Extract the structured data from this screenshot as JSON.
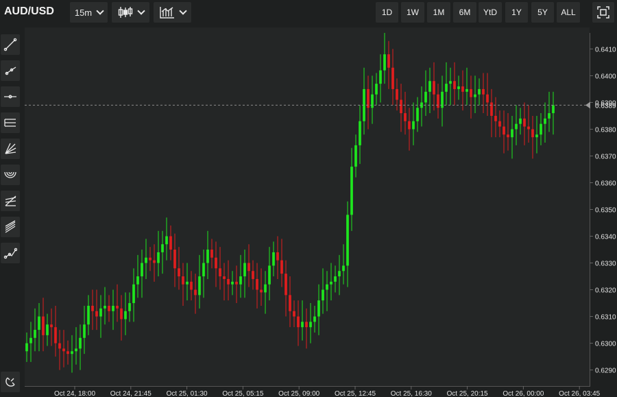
{
  "header": {
    "symbol": "AUD/USD",
    "interval_label": "15m",
    "chart_type_icon": "candlestick-icon",
    "indicators_icon": "indicators-icon",
    "ranges": [
      "1D",
      "1W",
      "1M",
      "6M",
      "YtD",
      "1Y",
      "5Y",
      "ALL"
    ],
    "fullscreen_icon": "fullscreen-icon"
  },
  "toolbar": {
    "tools": [
      "trend-line-icon",
      "ray-icon",
      "horizontal-line-icon",
      "parallel-channel-icon",
      "fib-fan-icon",
      "fib-arc-icon",
      "fib-retracement-icon",
      "pitchfork-icon",
      "path-icon",
      "magnet-icon"
    ]
  },
  "colors": {
    "up": "#1ee61e",
    "down": "#e01e1e",
    "background": "#242626",
    "axis_text": "#e0e0e0"
  },
  "chart_data": {
    "type": "candlestick",
    "title": "AUD/USD",
    "interval": "15m",
    "ylim": [
      0.6284,
      0.6416
    ],
    "y_ticks": [
      "0.6290",
      "0.6300",
      "0.6310",
      "0.6320",
      "0.6330",
      "0.6340",
      "0.6350",
      "0.6360",
      "0.6370",
      "0.6380",
      "0.6390",
      "0.6400",
      "0.6410"
    ],
    "x_ticks": [
      "Oct 24, 18:00",
      "Oct 24, 21:45",
      "Oct 25, 01:30",
      "Oct 25, 05:15",
      "Oct 25, 09:00",
      "Oct 25, 12:45",
      "Oct 25, 16:30",
      "Oct 25, 20:15",
      "Oct 26, 00:00",
      "Oct 26, 03:45"
    ],
    "last_price": "0.6389",
    "close": [
      0.63,
      0.6302,
      0.6305,
      0.631,
      0.6303,
      0.6307,
      0.6306,
      0.63,
      0.6298,
      0.6297,
      0.6296,
      0.6297,
      0.6298,
      0.6302,
      0.6307,
      0.6314,
      0.6312,
      0.631,
      0.6313,
      0.6314,
      0.6312,
      0.6314,
      0.6313,
      0.6309,
      0.6312,
      0.6315,
      0.6322,
      0.6325,
      0.633,
      0.6332,
      0.6331,
      0.633,
      0.6334,
      0.6337,
      0.634,
      0.6335,
      0.6328,
      0.6325,
      0.6322,
      0.6323,
      0.632,
      0.6318,
      0.6325,
      0.633,
      0.6335,
      0.6332,
      0.6328,
      0.6325,
      0.6324,
      0.6322,
      0.6323,
      0.6322,
      0.6325,
      0.633,
      0.6327,
      0.6324,
      0.632,
      0.6319,
      0.6322,
      0.6329,
      0.6334,
      0.6331,
      0.6326,
      0.6318,
      0.6312,
      0.631,
      0.6306,
      0.6308,
      0.6306,
      0.6308,
      0.631,
      0.6316,
      0.632,
      0.6322,
      0.6323,
      0.6325,
      0.6327,
      0.6329,
      0.6348,
      0.6366,
      0.6374,
      0.6383,
      0.6395,
      0.6388,
      0.6393,
      0.6397,
      0.6402,
      0.6408,
      0.6403,
      0.6395,
      0.6391,
      0.6386,
      0.6383,
      0.638,
      0.6383,
      0.6388,
      0.639,
      0.6394,
      0.6398,
      0.6393,
      0.6388,
      0.6394,
      0.6397,
      0.6398,
      0.6395,
      0.6396,
      0.6394,
      0.6395,
      0.6392,
      0.6393,
      0.6395,
      0.6393,
      0.639,
      0.6385,
      0.6383,
      0.6381,
      0.6378,
      0.6377,
      0.638,
      0.6382,
      0.6384,
      0.6381,
      0.638,
      0.6377,
      0.6378,
      0.6382,
      0.6384,
      0.6386,
      0.6389
    ],
    "open": [
      0.6297,
      0.63,
      0.6302,
      0.6305,
      0.631,
      0.6303,
      0.6307,
      0.6306,
      0.63,
      0.6298,
      0.6297,
      0.6296,
      0.6297,
      0.6298,
      0.6302,
      0.6307,
      0.6314,
      0.6312,
      0.631,
      0.6313,
      0.6314,
      0.6312,
      0.6314,
      0.6313,
      0.6309,
      0.6312,
      0.6315,
      0.6322,
      0.6325,
      0.633,
      0.6332,
      0.6331,
      0.633,
      0.6334,
      0.6337,
      0.634,
      0.6335,
      0.6328,
      0.6325,
      0.6322,
      0.6323,
      0.632,
      0.6318,
      0.6325,
      0.633,
      0.6335,
      0.6332,
      0.6328,
      0.6325,
      0.6324,
      0.6322,
      0.6323,
      0.6322,
      0.6325,
      0.633,
      0.6327,
      0.6324,
      0.632,
      0.6319,
      0.6322,
      0.6329,
      0.6334,
      0.6331,
      0.6326,
      0.6318,
      0.6312,
      0.631,
      0.6306,
      0.6308,
      0.6306,
      0.6308,
      0.631,
      0.6316,
      0.632,
      0.6322,
      0.6323,
      0.6325,
      0.6327,
      0.6329,
      0.6348,
      0.6366,
      0.6374,
      0.6383,
      0.6395,
      0.6388,
      0.6393,
      0.6397,
      0.6402,
      0.6408,
      0.6403,
      0.6395,
      0.6391,
      0.6386,
      0.6383,
      0.638,
      0.6383,
      0.6388,
      0.639,
      0.6394,
      0.6398,
      0.6393,
      0.6388,
      0.6394,
      0.6397,
      0.6398,
      0.6395,
      0.6396,
      0.6394,
      0.6395,
      0.6392,
      0.6393,
      0.6395,
      0.6393,
      0.639,
      0.6385,
      0.6383,
      0.6381,
      0.6378,
      0.6377,
      0.638,
      0.6382,
      0.6384,
      0.6381,
      0.638,
      0.6377,
      0.6378,
      0.6382,
      0.6384,
      0.6386
    ]
  }
}
